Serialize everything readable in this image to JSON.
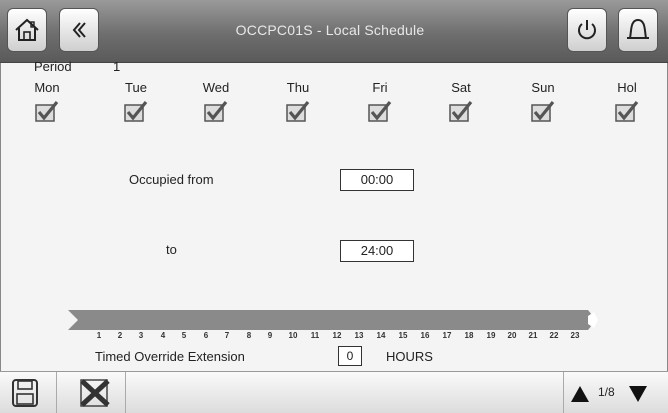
{
  "header": {
    "title": "OCCPC01S - Local Schedule",
    "icons": [
      "home-icon",
      "back-chevrons-icon",
      "power-icon",
      "alarm-bell-icon"
    ]
  },
  "period": {
    "label": "Period",
    "value": "1"
  },
  "days": [
    {
      "label": "Mon",
      "checked": true
    },
    {
      "label": "Tue",
      "checked": true
    },
    {
      "label": "Wed",
      "checked": true
    },
    {
      "label": "Thu",
      "checked": true
    },
    {
      "label": "Fri",
      "checked": true
    },
    {
      "label": "Sat",
      "checked": true
    },
    {
      "label": "Sun",
      "checked": true
    },
    {
      "label": "Hol",
      "checked": true
    }
  ],
  "occupied": {
    "from_label": "Occupied from",
    "from_value": "00:00",
    "to_label": "to",
    "to_value": "24:00"
  },
  "timeline": {
    "hours": [
      "1",
      "2",
      "3",
      "4",
      "5",
      "6",
      "7",
      "8",
      "9",
      "10",
      "11",
      "12",
      "13",
      "14",
      "15",
      "16",
      "17",
      "18",
      "19",
      "20",
      "21",
      "22",
      "23"
    ]
  },
  "override": {
    "label": "Timed Override Extension",
    "value": "0",
    "unit": "HOURS"
  },
  "footer": {
    "page_indicator": "1/8",
    "icons": [
      "save-icon",
      "cancel-x-icon",
      "page-up-icon",
      "page-down-icon"
    ]
  },
  "colors": {
    "header_dark": "#5a5a5a",
    "timeline_bar": "#8a8a8a",
    "check": "#555555"
  }
}
